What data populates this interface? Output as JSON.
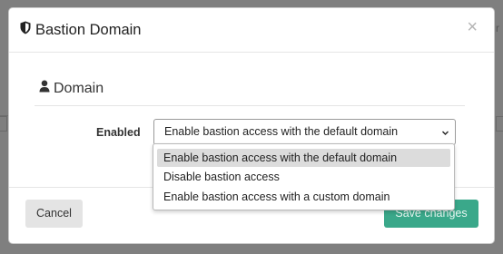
{
  "modal": {
    "title": "Bastion Domain",
    "title_icon": "shield-icon",
    "close_symbol": "×"
  },
  "section": {
    "heading": "Domain",
    "heading_icon": "user-icon"
  },
  "form": {
    "enabled_label": "Enabled",
    "select_value": "Enable bastion access with the default domain",
    "options": [
      "Enable bastion access with the default domain",
      "Disable bastion access",
      "Enable bastion access with a custom domain"
    ],
    "selected_index": 0
  },
  "footer": {
    "cancel_label": "Cancel",
    "save_label": "Save changes"
  },
  "colors": {
    "save_button": "#3aa88a",
    "backdrop": "#7f7f7f"
  }
}
